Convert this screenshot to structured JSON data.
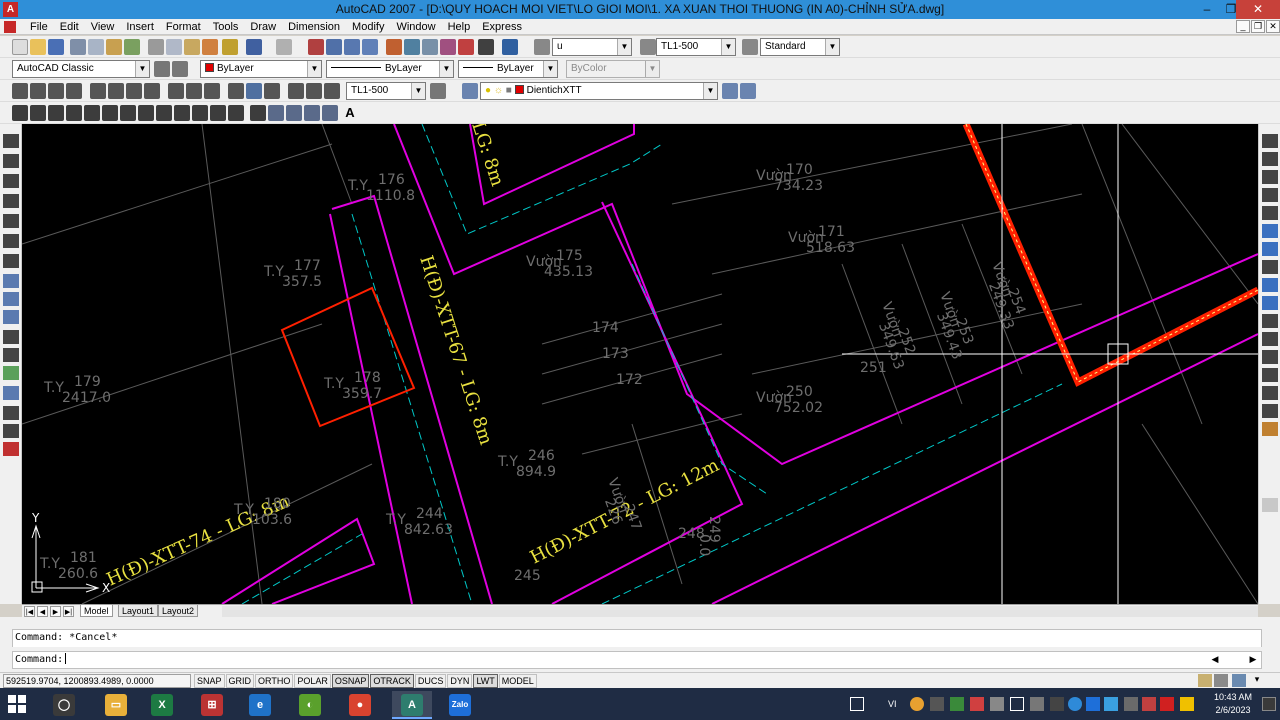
{
  "window": {
    "title": "AutoCAD 2007 - [D:\\QUY HOACH MOI VIET\\LO GIOI MOI\\1. XA XUAN THOI THUONG (IN A0)-CHỈNH SỬA.dwg]",
    "minimize": "–",
    "maximize": "❐",
    "close": "✕"
  },
  "menubar": {
    "items": [
      "File",
      "Edit",
      "View",
      "Insert",
      "Format",
      "Tools",
      "Draw",
      "Dimension",
      "Modify",
      "Window",
      "Help",
      "Express"
    ]
  },
  "toolbars": {
    "text_style": "u",
    "dim_style": "TL1-500",
    "table_style": "Standard",
    "workspace": "AutoCAD Classic",
    "color": "ByLayer",
    "color_hex": "#e00000",
    "linetype": "ByLayer",
    "lineweight": "ByLayer",
    "plotstyle": "ByColor",
    "dim_style_2": "TL1-500",
    "layer": "DientichXTT",
    "text_tool": "A"
  },
  "drawing": {
    "colors": {
      "background": "#000000",
      "road_boundary": "#e000e0",
      "centerline": "#00c8c8",
      "parcel_line": "#5a5a5a",
      "parcel_text": "#6e6e6e",
      "road_label": "#e8e040",
      "highlight": "#ff2000",
      "crosshair": "#ffffff"
    },
    "road_labels": [
      "LG: 8m",
      "H(Đ)-XTT-67 - LG: 8m",
      "H(Đ)-XTT-74 - LG: 8m",
      "H(Đ)-XTT-72 - LG: 12m"
    ],
    "parcels": [
      {
        "label": "T.Y",
        "id": "176",
        "area": "1110.8"
      },
      {
        "label": "T.Y",
        "id": "177",
        "area": "357.5"
      },
      {
        "label": "T.Y",
        "id": "178",
        "area": "359.7"
      },
      {
        "label": "T.Y",
        "id": "179",
        "area": "2417.0"
      },
      {
        "label": "T.Y",
        "id": "180",
        "area": "103.6"
      },
      {
        "label": "T.Y",
        "id": "181",
        "area": "260.6"
      },
      {
        "label": "Vườn",
        "id": "175",
        "area": "435.13"
      },
      {
        "label": "",
        "id": "174",
        "area": ""
      },
      {
        "label": "",
        "id": "173",
        "area": ""
      },
      {
        "label": "",
        "id": "172",
        "area": ""
      },
      {
        "label": "T.Y",
        "id": "246",
        "area": "894.9"
      },
      {
        "label": "T.Y",
        "id": "244",
        "area": "842.63"
      },
      {
        "label": "",
        "id": "245",
        "area": ""
      },
      {
        "label": "Vườn",
        "id": "247",
        "area": "226"
      },
      {
        "label": "",
        "id": "248",
        "area": ""
      },
      {
        "label": "",
        "id": "249",
        "area": "0.0"
      },
      {
        "label": "Vườn",
        "id": "170",
        "area": "734.23"
      },
      {
        "label": "Vườn",
        "id": "171",
        "area": "518.63"
      },
      {
        "label": "Vườn",
        "id": "250",
        "area": "752.02"
      },
      {
        "label": "",
        "id": "251",
        "area": ""
      },
      {
        "label": "Vườn",
        "id": "252",
        "area": "349.63"
      },
      {
        "label": "Vườn",
        "id": "253",
        "area": "349.43"
      },
      {
        "label": "Vườn",
        "id": "254",
        "area": "249.33"
      }
    ],
    "ucs": {
      "x": "X",
      "y": "Y"
    }
  },
  "layout_tabs": {
    "tabs": [
      "Model",
      "Layout1",
      "Layout2"
    ],
    "active": "Model"
  },
  "command": {
    "history": "Command: *Cancel*",
    "prompt": "Command:"
  },
  "status": {
    "coordinates": "592519.9704, 1200893.4989, 0.0000",
    "modes": [
      {
        "label": "SNAP",
        "on": false
      },
      {
        "label": "GRID",
        "on": false
      },
      {
        "label": "ORTHO",
        "on": false
      },
      {
        "label": "POLAR",
        "on": false
      },
      {
        "label": "OSNAP",
        "on": true
      },
      {
        "label": "OTRACK",
        "on": true
      },
      {
        "label": "DUCS",
        "on": false
      },
      {
        "label": "DYN",
        "on": false
      },
      {
        "label": "LWT",
        "on": true
      },
      {
        "label": "MODEL",
        "on": false
      }
    ]
  },
  "taskbar": {
    "apps": [
      {
        "name": "cortana",
        "glyph": "◯",
        "color": "#3a3a3a"
      },
      {
        "name": "file-explorer",
        "glyph": "▭",
        "color": "#e8b03a"
      },
      {
        "name": "excel",
        "glyph": "X",
        "color": "#1d7a43"
      },
      {
        "name": "app-red",
        "glyph": "⊞",
        "color": "#b33"
      },
      {
        "name": "internet-explorer",
        "glyph": "e",
        "color": "#1f72c8"
      },
      {
        "name": "coc-coc",
        "glyph": "◐",
        "color": "#5aa02c"
      },
      {
        "name": "chrome",
        "glyph": "●",
        "color": "#d9432f"
      },
      {
        "name": "autocad",
        "glyph": "A",
        "color": "#2e7d6e"
      },
      {
        "name": "zalo",
        "glyph": "Zalo",
        "color": "#1e6fd9"
      }
    ],
    "language": "VI",
    "time": "10:43 AM",
    "date": "2/6/2023"
  }
}
